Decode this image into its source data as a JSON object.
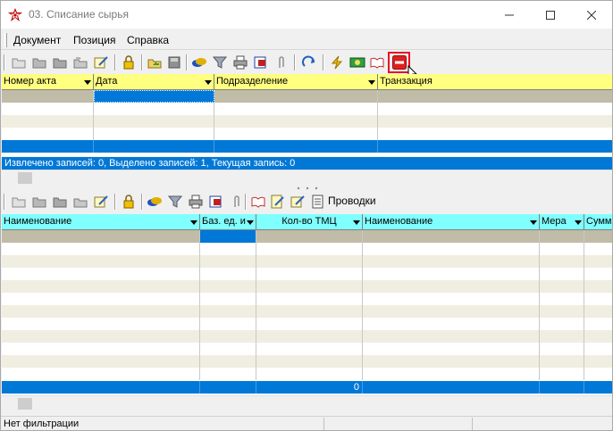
{
  "window": {
    "title": "03. Списание сырья"
  },
  "menu": [
    {
      "label": "Документ"
    },
    {
      "label": "Позиция"
    },
    {
      "label": "Справка"
    }
  ],
  "top_grid": {
    "columns": [
      {
        "label": "Номер акта"
      },
      {
        "label": "Дата"
      },
      {
        "label": "Подразделение"
      },
      {
        "label": "Транзакция"
      }
    ],
    "status": "Извлечено записей: 0, Выделено записей: 1, Текущая запись: 0"
  },
  "bottom_toolbar": {
    "provodki_label": "Проводки"
  },
  "bottom_grid": {
    "columns": [
      {
        "label": "Наименование"
      },
      {
        "label": "Баз. ед. и"
      },
      {
        "label": "Кол-во ТМЦ"
      },
      {
        "label": "Наименование"
      },
      {
        "label": "Мера"
      },
      {
        "label": "Сумма"
      }
    ],
    "total_qty": "0"
  },
  "statusbar": {
    "filter": "Нет фильтрации"
  },
  "colors": {
    "top_header": "#ffff80",
    "bottom_header": "#80ffff",
    "selection": "#0078d7",
    "stop_button_highlight": "#e81123"
  }
}
